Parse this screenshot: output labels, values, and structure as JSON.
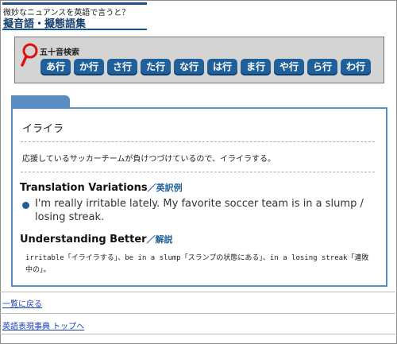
{
  "header": {
    "tagline": "微妙なニュアンスを英語で言うと？",
    "title": "擬音語・擬態語集"
  },
  "search": {
    "label": "五十音検索",
    "kana": [
      "あ行",
      "か行",
      "さ行",
      "た行",
      "な行",
      "は行",
      "ま行",
      "や行",
      "ら行",
      "わ行"
    ]
  },
  "entry": {
    "word": "イライラ",
    "example": "応援しているサッカーチームが負けつづけているので、イライラする。",
    "translation_heading_en": "Translation Variations",
    "translation_heading_jp": "／英訳例",
    "translations": [
      "I'm really irritable lately. My favorite soccer team is in a slump / losing streak."
    ],
    "understanding_heading_en": "Understanding Better",
    "understanding_heading_jp": "／解説",
    "explanation": "irritable「イライラする」、be in a slump「スランプの状態にある」、in a losing streak「連敗中の」。"
  },
  "footer": {
    "back_link": "一覧に戻る",
    "top_link": "英語表現事典 トップへ"
  },
  "colors": {
    "accent": "#1f5f9a",
    "card_border": "#5b8cc3",
    "search_bg": "#d4d4d4"
  }
}
